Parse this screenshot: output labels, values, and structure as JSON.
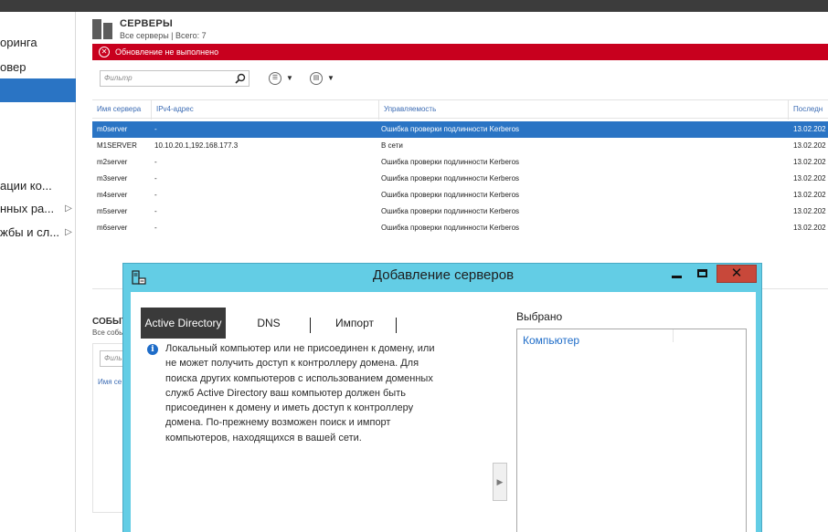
{
  "left_nav": {
    "items": [
      {
        "label": "оринга",
        "has_arrow": false,
        "selected": false
      },
      {
        "label": "овер",
        "has_arrow": false,
        "selected": false
      },
      {
        "label": "",
        "has_arrow": false,
        "selected": true
      },
      {
        "label": "ации ко...",
        "has_arrow": false,
        "selected": false
      },
      {
        "label": "нных ра...",
        "has_arrow": true,
        "selected": false
      },
      {
        "label": "жбы и сл...",
        "has_arrow": true,
        "selected": false
      }
    ],
    "arrow_glyph": "▷"
  },
  "servers": {
    "title": "СЕРВЕРЫ",
    "subtitle": "Все серверы | Всего: 7",
    "error": "Обновление не выполнено",
    "filter_placeholder": "Фильтр",
    "columns": [
      "Имя сервера",
      "IPv4-адрес",
      "Управляемость",
      "Последн"
    ],
    "rows": [
      {
        "name": "m0server",
        "ip": "-",
        "status": "Ошибка проверки подлинности Kerberos",
        "date": "13.02.202",
        "selected": true
      },
      {
        "name": "M1SERVER",
        "ip": "10.10.20.1,192.168.177.3",
        "status": "В сети",
        "date": "13.02.202",
        "selected": false
      },
      {
        "name": "m2server",
        "ip": "-",
        "status": "Ошибка проверки подлинности Kerberos",
        "date": "13.02.202",
        "selected": false
      },
      {
        "name": "m3server",
        "ip": "-",
        "status": "Ошибка проверки подлинности Kerberos",
        "date": "13.02.202",
        "selected": false
      },
      {
        "name": "m4server",
        "ip": "-",
        "status": "Ошибка проверки подлинности Kerberos",
        "date": "13.02.202",
        "selected": false
      },
      {
        "name": "m5server",
        "ip": "-",
        "status": "Ошибка проверки подлинности Kerberos",
        "date": "13.02.202",
        "selected": false
      },
      {
        "name": "m6server",
        "ip": "-",
        "status": "Ошибка проверки подлинности Kerberos",
        "date": "13.02.202",
        "selected": false
      }
    ]
  },
  "events": {
    "title": "СОБЫТ",
    "subtitle": "Все собы",
    "filter_placeholder": "Филь",
    "column": "Имя се"
  },
  "dialog": {
    "title": "Добавление серверов",
    "tabs": [
      "Active Directory",
      "DNS",
      "Импорт"
    ],
    "info_lines": [
      "Локальный компьютер или не присоединен к домену, или",
      "не может получить доступ к контроллеру домена. Для",
      "поиска других компьютеров с использованием доменных",
      "служб Active Directory ваш компьютер должен быть",
      "присоединен к домену и иметь доступ к контроллеру",
      "домена. По-прежнему возможен поиск и импорт",
      "компьютеров, находящихся в вашей сети."
    ],
    "selected_label": "Выбрано",
    "selected_items": [
      "Компьютер"
    ],
    "close_glyph": "✕",
    "add_glyph": "▶"
  },
  "colors": {
    "accent": "#2a74c4",
    "error": "#c8001e",
    "dialog_frame": "#63cde5",
    "close_button": "#c8483a"
  }
}
